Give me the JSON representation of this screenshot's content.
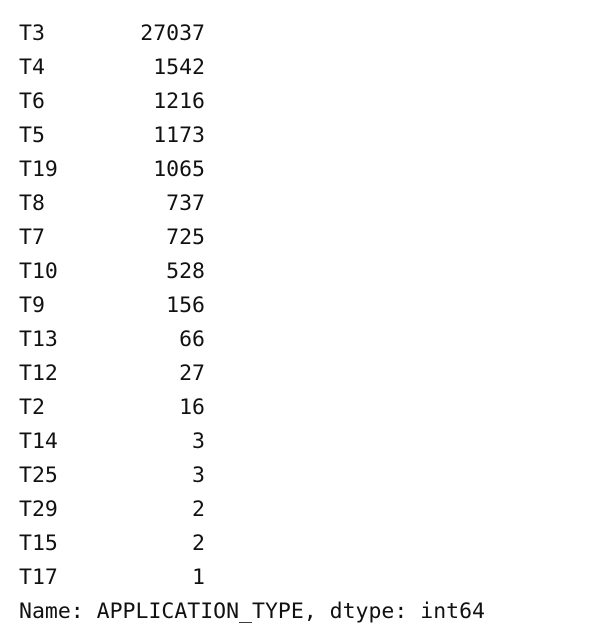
{
  "series_output": {
    "rows": [
      {
        "label": "T3",
        "count": "27037"
      },
      {
        "label": "T4",
        "count": "1542"
      },
      {
        "label": "T6",
        "count": "1216"
      },
      {
        "label": "T5",
        "count": "1173"
      },
      {
        "label": "T19",
        "count": "1065"
      },
      {
        "label": "T8",
        "count": "737"
      },
      {
        "label": "T7",
        "count": "725"
      },
      {
        "label": "T10",
        "count": "528"
      },
      {
        "label": "T9",
        "count": "156"
      },
      {
        "label": "T13",
        "count": "66"
      },
      {
        "label": "T12",
        "count": "27"
      },
      {
        "label": "T2",
        "count": "16"
      },
      {
        "label": "T14",
        "count": "3"
      },
      {
        "label": "T25",
        "count": "3"
      },
      {
        "label": "T29",
        "count": "2"
      },
      {
        "label": "T15",
        "count": "2"
      },
      {
        "label": "T17",
        "count": "1"
      }
    ],
    "footer": "Name: APPLICATION_TYPE, dtype: int64"
  }
}
